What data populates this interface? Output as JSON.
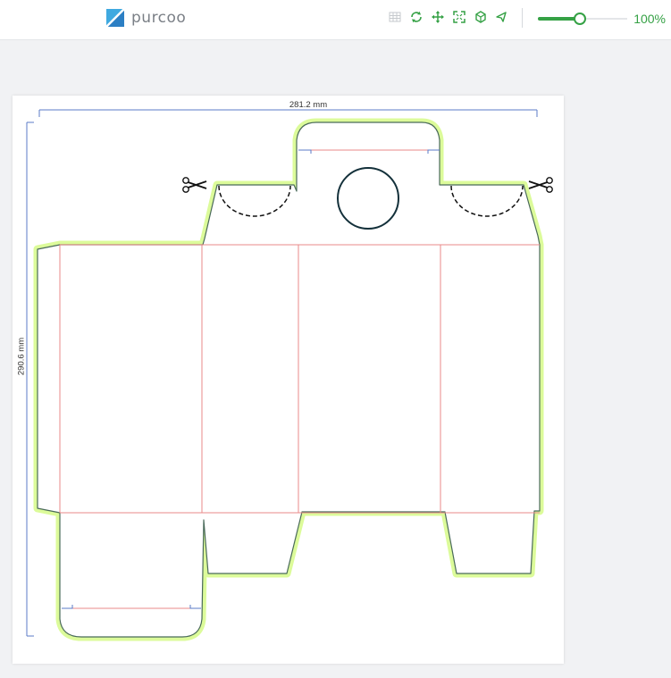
{
  "header": {
    "brand": "purcoo",
    "zoom_level": 1.0,
    "zoom_label": "100%",
    "tools": [
      "grid-icon",
      "rotate-icon",
      "move-icon",
      "fit-screen-icon",
      "3d-view-icon",
      "navigate-icon"
    ]
  },
  "dieline": {
    "width_label": "281.2 mm",
    "height_label": "290.6 mm"
  },
  "colors": {
    "accent": "#35a145",
    "bleed": "#dcfb9a",
    "cut_line": "#4a6a5a",
    "fold_line": "#e88a8a",
    "dimension_line": "#5b7bc7"
  }
}
